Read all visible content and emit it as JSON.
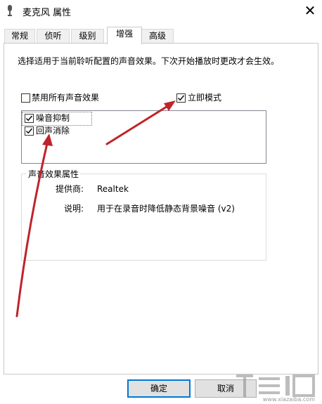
{
  "window": {
    "title": "麦克风 属性",
    "close_glyph": "✕"
  },
  "tabs": [
    {
      "label": "常规"
    },
    {
      "label": "侦听"
    },
    {
      "label": "级别"
    },
    {
      "label": "增强",
      "active": true
    },
    {
      "label": "高级"
    }
  ],
  "enhancements": {
    "description": "选择适用于当前聆听配置的声音效果。下次开始播放时更改才会生效。",
    "disable_all": {
      "label": "禁用所有声音效果",
      "checked": false
    },
    "immediate_mode": {
      "label": "立即模式",
      "checked": true
    },
    "effects": [
      {
        "label": "噪音抑制",
        "checked": true
      },
      {
        "label": "回声消除",
        "checked": true
      }
    ]
  },
  "properties": {
    "group_title": "声音效果属性",
    "provider_label": "提供商:",
    "provider_value": "Realtek",
    "desc_label": "说明:",
    "desc_value": "用于在录音时降低静态背景噪音 (v2)"
  },
  "buttons": {
    "ok": "确定",
    "cancel": "取消"
  },
  "watermark": {
    "site": "www.xiazaiba.com"
  },
  "colors": {
    "arrow": "#c0232b",
    "check": "#000000",
    "accent": "#0078d7"
  }
}
